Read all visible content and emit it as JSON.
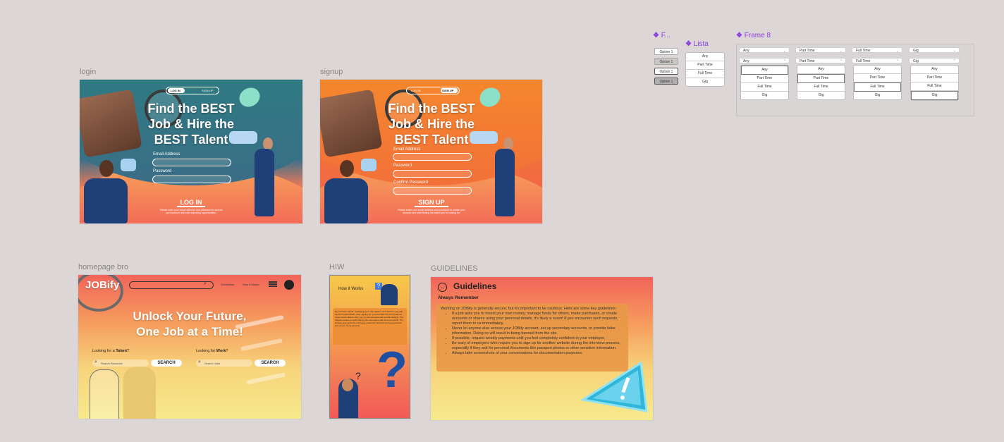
{
  "frames": {
    "login_label": "login",
    "signup_label": "signup",
    "homepage_label": "homepage bro",
    "hiw_label": "HIW",
    "guidelines_label": "GUIDELINES",
    "f_label": "F...",
    "lista_label": "Lista",
    "frame8_label": "Frame 8"
  },
  "login": {
    "toggle_login": "LOG IN",
    "toggle_signup": "SIGN UP",
    "title_line1": "Find the BEST",
    "title_line2": "Job & Hire the",
    "title_line3": "BEST Talent",
    "email_label": "Email Address",
    "password_label": "Password",
    "button": "LOG IN",
    "footer": "Please enter your email address and password to access your account and start exploring opportunities."
  },
  "signup": {
    "toggle_login": "LOG IN",
    "toggle_signup": "SIGN UP",
    "title_line1": "Find the BEST",
    "title_line2": "Job & Hire the",
    "title_line3": "BEST Talent",
    "email_label": "Email Address",
    "password_label": "Password",
    "confirm_label": "Confirm Password",
    "button": "SIGN UP",
    "footer": "Please enter your email address and password to create your account and start finding the talent you're looking for."
  },
  "homepage": {
    "logo": "JOBify",
    "nav_guidelines": "Guidelines",
    "nav_how": "How it Works",
    "headline1": "Unlock Your Future,",
    "headline2": "One Job at a Time!",
    "talent_prefix": "Looking for a ",
    "talent_word": "Talent",
    "talent_suffix": "?",
    "work_prefix": "Looking for ",
    "work_word": "Work",
    "work_suffix": "?",
    "search_resumes_placeholder": "Search Resumes",
    "search_jobs_placeholder": "Search Jobs",
    "search_button": "SEARCH"
  },
  "hiw": {
    "title": "How it Works",
    "body": "By purchase capital, shortlisting your own desired and selection you with the best opportunities. After signing up, you'll be taken to your profile for where you're able to offer, set up your personal and specific settings. The features unique in customising your own space and focus on results. The website also works by a dynamic method to help find your desired work and ensure hiring success."
  },
  "guidelines": {
    "title": "Guidelines",
    "subtitle": "Always Remember",
    "intro": "Working on JOBify is generally secure, but it's important to be cautious. Here are some key guidelines:",
    "items": [
      "If a job asks you to invest your own money, manage funds for others, make purchases, or create accounts or shares using your personal details, it's likely a scam! If you encounter such requests, report them to us immediately.",
      "Never let anyone else access your JOBify account, set up secondary accounts, or provide false information. Doing so will result in being banned from the site.",
      "If possible, request weekly payments until you feel completely confident in your employer.",
      "Be wary of employers who require you to sign up for another website during the interview process, especially if they ask for personal documents like passport photos or other sensitive information.",
      "Always take screenshots of your conversations for documentation purposes."
    ]
  },
  "options": [
    "Option 1",
    "Option 1",
    "Option 1",
    "Option 1"
  ],
  "lista_items": [
    "Any",
    "Part Time",
    "Full Time",
    "Gig"
  ],
  "frame8": {
    "selects": [
      "Any",
      "Part Time",
      "Full Time",
      "Gig"
    ],
    "list_items": [
      "Any",
      "Part Time",
      "Full Time",
      "Gig"
    ]
  },
  "colors": {
    "teal": "#2b7d7e",
    "orange": "#f08a24",
    "coral": "#f26a5c",
    "yellow": "#f7e98a",
    "accent_purple": "#8b3fe0"
  }
}
